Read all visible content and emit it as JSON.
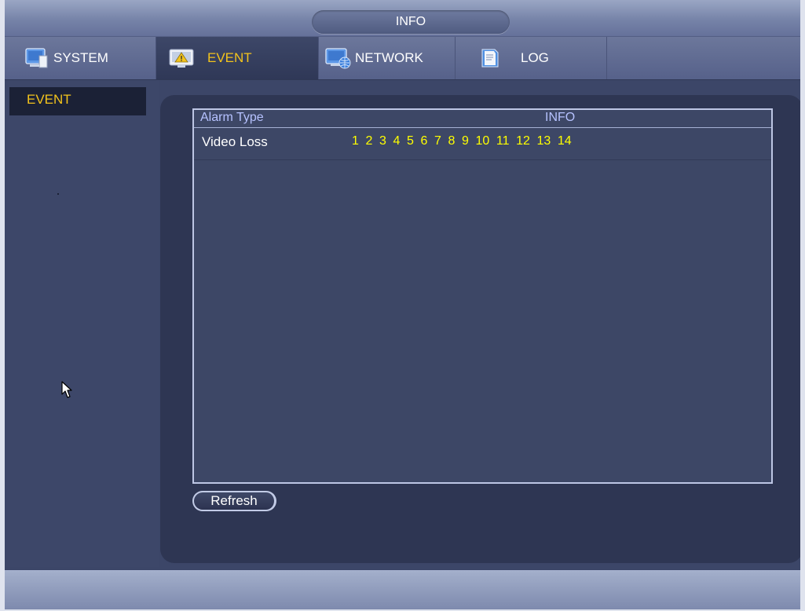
{
  "title": "INFO",
  "tabs": [
    {
      "label": "SYSTEM",
      "icon": "monitor-icon"
    },
    {
      "label": "EVENT",
      "icon": "event-monitor-icon"
    },
    {
      "label": "NETWORK",
      "icon": "network-icon"
    },
    {
      "label": "LOG",
      "icon": "log-book-icon"
    }
  ],
  "active_tab": "EVENT",
  "sidebar": {
    "items": [
      {
        "label": "EVENT"
      }
    ]
  },
  "table": {
    "columns": [
      "Alarm Type",
      "INFO"
    ],
    "rows": [
      {
        "alarm_type": "Video Loss",
        "channels": [
          "1",
          "2",
          "3",
          "4",
          "5",
          "6",
          "7",
          "8",
          "9",
          "10",
          "11",
          "12",
          "13",
          "14"
        ]
      }
    ]
  },
  "refresh_label": "Refresh",
  "colors": {
    "highlight": "#f2c31c",
    "channel": "#ffff00",
    "header_text": "#b6c2ff",
    "panel": "#2e3653",
    "background": "#3c4668"
  }
}
